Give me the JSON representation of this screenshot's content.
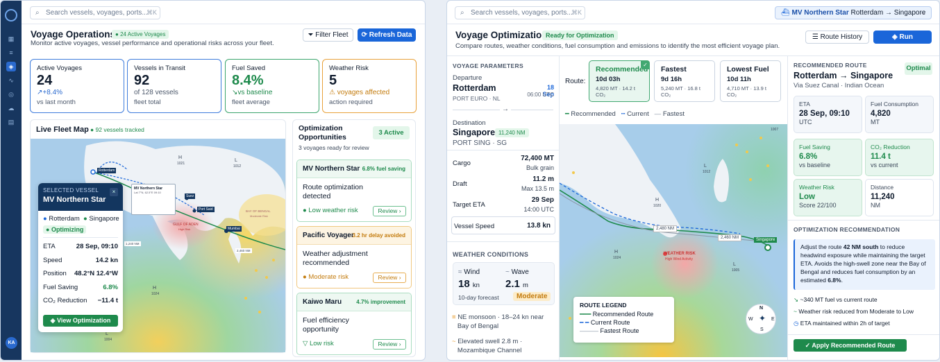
{
  "left": {
    "search": {
      "placeholder": "Search vessels, voyages, ports...",
      "kbd": "⌘K"
    },
    "title": "Voyage Operations",
    "badge": "24 Active Voyages",
    "subtitle": "Monitor active voyages, vessel performance and operational risks across your fleet.",
    "filter_label": "Filter Fleet",
    "refresh_label": "Refresh Data",
    "avatar": "KA",
    "kpis": [
      {
        "label": "Active Voyages",
        "value": "24",
        "delta": "+8.4%",
        "sub": "vs last month"
      },
      {
        "label": "Vessels in Transit",
        "value": "92",
        "delta": "of 128 vessels",
        "sub": "fleet total"
      },
      {
        "label": "Fuel Saved",
        "value": "8.4%",
        "delta": "vs baseline",
        "sub": "fleet average"
      },
      {
        "label": "Weather Risk",
        "value": "5",
        "delta": "voyages affected",
        "sub": "action required"
      }
    ],
    "map": {
      "title": "Live Fleet Map",
      "tracked": "92 vessels tracked",
      "labels": {
        "rotterdam": "Rotterdam",
        "suez": "Suez",
        "port_said": "Port Said",
        "mumbai": "Mumbai",
        "gulf": "GULF OF ADEN",
        "gulf_sub": "High Risk",
        "bay": "BAY OF BENGAL",
        "bay_sub": "Moderate Risk",
        "d1": "1,240 NM",
        "d2": "2,460 NM",
        "h1": "H",
        "h1v": "1021",
        "l1": "L",
        "l1v": "1012",
        "h2": "H",
        "h2v": "1024",
        "l2": "L",
        "l2v": "1004",
        "tip": "MV Northern Star",
        "tip_sub": "Lat 7°N, 62.5°E 09:10"
      }
    },
    "popup": {
      "head": "SELECTED VESSEL",
      "name": "MV Northern Star",
      "from": "Rotterdam",
      "to": "Singapore",
      "status": "Optimizing",
      "rows": [
        {
          "l": "ETA",
          "v": "28 Sep, 09:10"
        },
        {
          "l": "Speed",
          "v": "14.2 kn"
        },
        {
          "l": "Position",
          "v": "48.2°N 12.4°W"
        },
        {
          "l": "Fuel Saving",
          "v": "6.8%"
        },
        {
          "l": "CO₂ Reduction",
          "v": "−11.4 t"
        }
      ],
      "button": "View Optimization"
    },
    "opt": {
      "title1": "Optimization",
      "title2": "Opportunities",
      "count": "3 Active",
      "sub": "3 voyages ready for review",
      "cards": [
        {
          "name": "MV Northern Star",
          "gain": "6.8% fuel saving",
          "b1": "Route optimization",
          "b2": "detected",
          "risk": "Low weather risk",
          "review": "Review"
        },
        {
          "name": "Pacific Voyager",
          "gain": "3.2 hr delay avoided",
          "b1": "Weather adjustment",
          "b2": "recommended",
          "risk": "Moderate risk",
          "review": "Review"
        },
        {
          "name": "Kaiwo Maru",
          "gain": "4.7% improvement",
          "b1": "Fuel efficiency",
          "b2": "opportunity",
          "risk": "Low risk",
          "review": "Review"
        }
      ]
    }
  },
  "right": {
    "search": {
      "placeholder": "Search vessels, voyages, ports...",
      "kbd": "⌘K"
    },
    "vessel": "MV Northern Star",
    "route": "Rotterdam → Singapore",
    "title": "Voyage Optimization",
    "badge": "Ready for Optimization",
    "subtitle": "Compare routes, weather conditions, fuel consumption and emissions to identify the most efficient voyage plan.",
    "history": "Route History",
    "run": "Run Optimization",
    "params": {
      "head": "VOYAGE PARAMETERS",
      "dep_l": "Departure",
      "dep": "Rotterdam",
      "dep_date": "18 Sep",
      "dep_time": "06:00 UTC",
      "dep_port": "PORT EURO · NL",
      "dest_l": "Destination",
      "dest": "Singapore",
      "dest_nm": "11,240 NM",
      "dest_port": "PORT SING · SG",
      "rows": [
        {
          "l": "Cargo",
          "v": "72,400 MT",
          "s": "Bulk grain"
        },
        {
          "l": "Draft",
          "v": "11.2 m",
          "s": "Max 13.5 m"
        },
        {
          "l": "Target ETA",
          "v": "29 Sep",
          "s": "14:00 UTC"
        },
        {
          "l": "Vessel Speed",
          "v": "13.8 kn",
          "s": ""
        }
      ]
    },
    "weather": {
      "head": "WEATHER CONDITIONS",
      "wind_l": "Wind",
      "wind": "18",
      "wind_u": "kn",
      "wave_l": "Wave",
      "wave": "2.1",
      "wave_u": "m",
      "fc": "10-day forecast",
      "level": "Moderate",
      "n1": "NE monsoon · 18–24 kn near",
      "n1b": "Bay of Bengal",
      "n2": "Elevated swell 2.8 m ·",
      "n2b": "Mozambique Channel"
    },
    "route_label": "Route:",
    "tabs": [
      {
        "t": "Recommended",
        "v": "10d 03h",
        "s": "4,820 MT · 14.2 t CO₂"
      },
      {
        "t": "Fastest",
        "v": "9d 16h",
        "s": "5,240 MT · 16.8 t CO₂"
      },
      {
        "t": "Lowest Fuel",
        "v": "10d 11h",
        "s": "4,710 MT · 13.9 t CO₂"
      }
    ],
    "legend_top": [
      "Recommended",
      "Current",
      "Fastest"
    ],
    "map": {
      "legend_title": "ROUTE LEGEND",
      "legend": [
        "Recommended Route",
        "Current Route",
        "Fastest Route"
      ],
      "d1": "2,480 NM",
      "d2": "2,460 NM",
      "sing": "Singapore",
      "risk": "WEATHER RISK",
      "risk_sub": "High Wind Activity",
      "h1": "H",
      "h1v": "1020",
      "l1": "L",
      "l1v": "1012",
      "h2": "H",
      "h2v": "1024",
      "l2": "L",
      "l2v": "1005",
      "hv": "1007",
      "compass": {
        "n": "N",
        "s": "S",
        "e": "E",
        "w": "W"
      }
    },
    "rec": {
      "head": "RECOMMENDED ROUTE",
      "route": "Rotterdam → Singapore",
      "badge": "Optimal",
      "via": "Via Suez Canal · Indian Ocean",
      "cards": [
        {
          "l": "ETA",
          "v": "28 Sep, 09:10",
          "s": "UTC"
        },
        {
          "l": "Fuel Consumption",
          "v": "4,820",
          "s": "MT"
        },
        {
          "l": "Fuel Saving",
          "v": "6.8%",
          "s": "vs baseline"
        },
        {
          "l": "CO₂ Reduction",
          "v": "11.4 t",
          "s": "vs current"
        },
        {
          "l": "Weather Risk",
          "v": "Low",
          "s": "Score 22/100"
        },
        {
          "l": "Distance",
          "v": "11,240",
          "s": "NM"
        }
      ],
      "opt_head": "OPTIMIZATION RECOMMENDATION",
      "note": {
        "a": "Adjust the route ",
        "b": "42 NM south",
        "c": " to reduce headwind exposure while maintaining the target ETA. Avoids the high-swell zone near the Bay of Bengal and reduces fuel consumption by an estimated ",
        "d": "6.8%",
        "e": "."
      },
      "bullets": [
        "~340 MT fuel vs current route",
        "Weather risk reduced from Moderate to Low",
        "ETA maintained within 2h of target"
      ],
      "apply": "Apply Recommended Route"
    }
  },
  "colors": {
    "navy": "#17365f",
    "primary": "#1a66d9",
    "green": "#1e8a4c",
    "amber": "#c37b0d"
  }
}
